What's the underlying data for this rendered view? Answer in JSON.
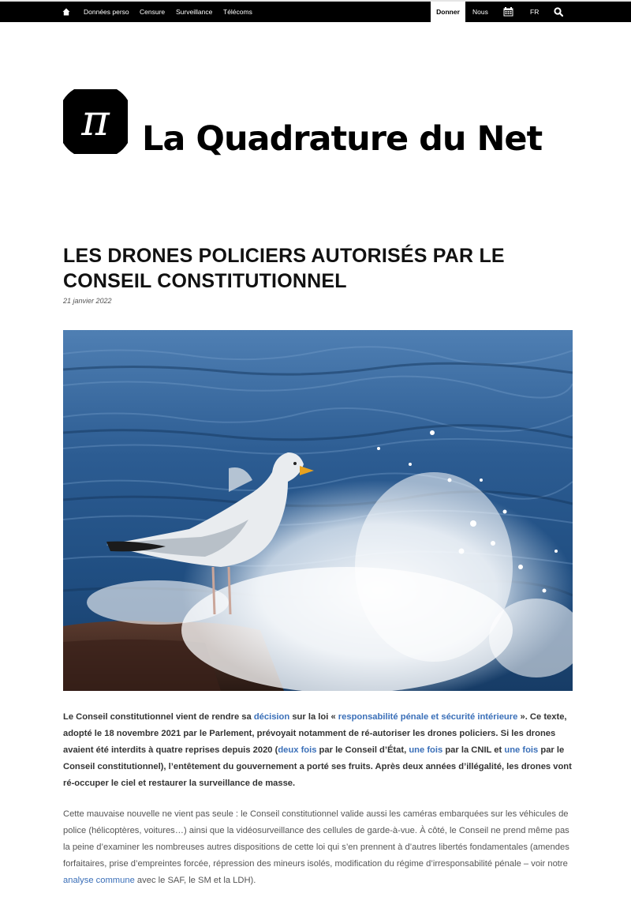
{
  "nav": {
    "home_icon": "home-icon",
    "items": [
      "Données perso",
      "Censure",
      "Surveillance",
      "Télécoms"
    ],
    "donner": "Donner",
    "nous": "Nous",
    "calendar_icon": "calendar-icon",
    "lang": "FR",
    "search_icon": "search-icon"
  },
  "brand": {
    "name": "La Quadrature du Net",
    "logo_glyph": "π"
  },
  "article": {
    "title": "LES DRONES POLICIERS AUTORISÉS PAR LE CONSEIL CONSTITUTIONNEL",
    "date": "21 janvier 2022",
    "p1": {
      "t1": "Le Conseil constitutionnel vient de rendre sa ",
      "l1": "décision",
      "t2": " sur la loi « ",
      "l2": "responsabilité pénale et sécurité intérieure",
      "t3": " ». Ce texte, adopté le 18 novembre 2021 par le Parlement, prévoyait notamment de ré-autoriser les drones policiers. Si les drones avaient été interdits à quatre reprises depuis 2020 (",
      "l3": "deux fois",
      "t4": " par le Conseil d’État, ",
      "l4": "une fois",
      "t5": " par la CNIL et ",
      "l5": "une fois",
      "t6": " par le Conseil constitutionnel), l’entêtement du gouvernement a porté ses fruits. Après deux années d’illégalité, les drones vont ré-occuper le ciel et restaurer la surveillance de masse."
    },
    "p2": {
      "t1": "Cette mauvaise nouvelle ne vient pas seule : le Conseil constitutionnel valide aussi les caméras embarquées sur les véhicules de police (hélicoptères, voitures…) ainsi que la vidéosurveillance des cellules de garde-à-vue. À côté, le Conseil ne prend même pas la peine d’examiner les nombreuses autres dispositions de cette loi qui s’en prennent à d’autres libertés fondamentales (amendes forfaitaires, prise d’empreintes forcée, répression des mineurs isolés, modification du régime d’irresponsabilité pénale – voir notre ",
      "l1": "analyse commune",
      "t2": " avec le SAF, le SM et la LDH)."
    }
  },
  "colors": {
    "nav_bg": "#000000",
    "link": "#3a6fb8",
    "sea": "#2a5a8c"
  }
}
